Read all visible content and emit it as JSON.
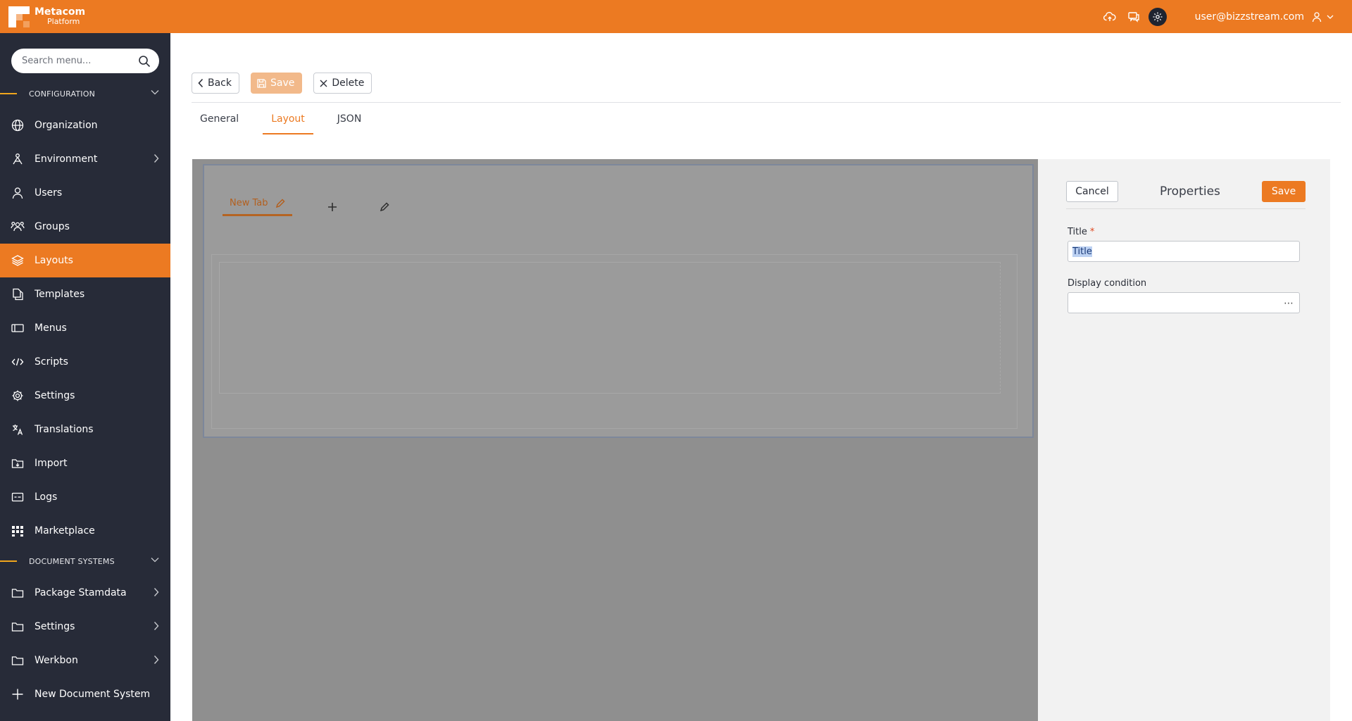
{
  "brand": {
    "name": "Metacom",
    "sub": "Platform",
    "color": "#ec7a22"
  },
  "header": {
    "icons": [
      "cloud-upload-icon",
      "chat-icon",
      "gear-icon"
    ],
    "user_email": "user@bizzstream.com"
  },
  "sidebar": {
    "search_placeholder": "Search menu...",
    "sections": [
      {
        "label": "CONFIGURATION",
        "items": [
          {
            "label": "Organization",
            "icon": "globe-icon"
          },
          {
            "label": "Environment",
            "icon": "environment-icon",
            "has_children": true
          },
          {
            "label": "Users",
            "icon": "user-icon"
          },
          {
            "label": "Groups",
            "icon": "groups-icon"
          },
          {
            "label": "Layouts",
            "icon": "layers-icon",
            "active": true
          },
          {
            "label": "Templates",
            "icon": "templates-icon"
          },
          {
            "label": "Menus",
            "icon": "menus-icon"
          },
          {
            "label": "Scripts",
            "icon": "scripts-icon"
          },
          {
            "label": "Settings",
            "icon": "gear-icon"
          },
          {
            "label": "Translations",
            "icon": "translate-icon"
          },
          {
            "label": "Import",
            "icon": "import-icon"
          },
          {
            "label": "Logs",
            "icon": "logs-icon"
          },
          {
            "label": "Marketplace",
            "icon": "marketplace-icon"
          }
        ]
      },
      {
        "label": "DOCUMENT SYSTEMS",
        "items": [
          {
            "label": "Package Stamdata",
            "icon": "folder-icon",
            "has_children": true
          },
          {
            "label": "Settings",
            "icon": "folder-icon",
            "has_children": true
          },
          {
            "label": "Werkbon",
            "icon": "folder-icon",
            "has_children": true
          },
          {
            "label": "New Document System",
            "icon": "plus-icon"
          }
        ]
      }
    ]
  },
  "toolbar": {
    "back_label": "Back",
    "save_label": "Save",
    "delete_label": "Delete"
  },
  "tabs": [
    {
      "label": "General",
      "active": false
    },
    {
      "label": "Layout",
      "active": true
    },
    {
      "label": "JSON",
      "active": false
    }
  ],
  "layout_editor": {
    "tab_label": "New Tab"
  },
  "properties": {
    "title": "Properties",
    "cancel_label": "Cancel",
    "save_label": "Save",
    "title_field": {
      "label": "Title",
      "required_mark": "*",
      "value": "Title"
    },
    "display_condition": {
      "label": "Display condition",
      "value": "",
      "more": "⋯"
    }
  }
}
